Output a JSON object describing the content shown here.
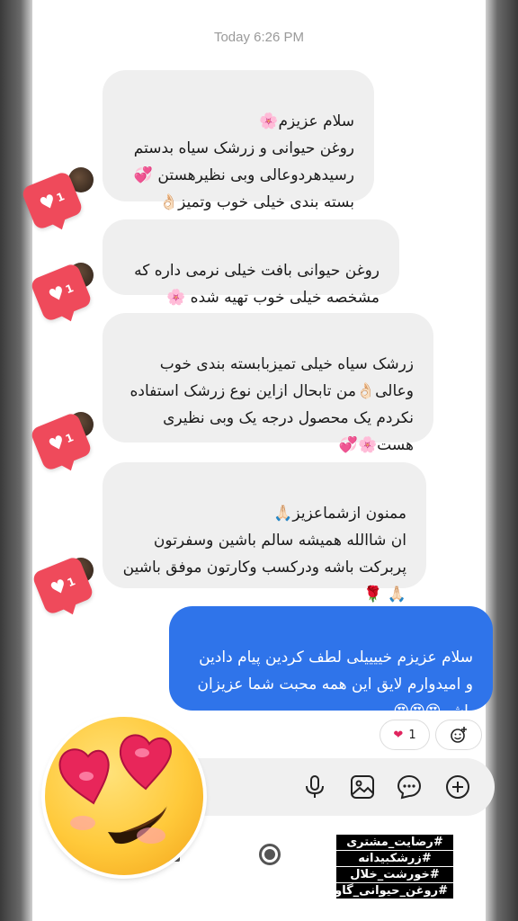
{
  "conversation": {
    "timestamp": "Today 6:26 PM",
    "messages": [
      {
        "from": "them",
        "text": "سلام عزیزم🌸\nروغن حیوانی و زرشک سیاه بدستم\nرسیدهردوعالی وبی نظیرهستن 💞\nبسته بندی خیلی خوب وتمیز👌🏻",
        "likes": "1"
      },
      {
        "from": "them",
        "text": "روغن حیوانی بافت خیلی نرمی داره که\nمشخصه خیلی خوب تهیه شده 🌸",
        "likes": "1"
      },
      {
        "from": "them",
        "text": "زرشک سیاه خیلی تمیزبابسته بندی خوب\nوعالی👌🏻من تابحال ازاین نوع زرشک استفاده\nنکردم یک محصول درجه یک وبی نظیری\nهست🌸💞",
        "likes": "1"
      },
      {
        "from": "them",
        "text": "ممنون ازشماعزیز🙏🏻\nان شاالله همیشه سالم باشین وسفرتون\nپربرکت باشه ودرکسب وکارتون موفق باشین\n🙏🏻 🌹",
        "likes": "1"
      },
      {
        "from": "me",
        "text": "سلام عزیزم خییییلی لطف کردین پیام دادین\nو امیدوارم لایق این همه محبت شما عزیزان\nباشم😍😍😍"
      }
    ],
    "reaction": {
      "emoji": "❤",
      "count": "1"
    },
    "reaction_add_icon": "add-reaction-icon"
  },
  "composer": {
    "icons": [
      "microphone-icon",
      "image-icon",
      "sticker-icon",
      "plus-icon"
    ]
  },
  "overlay": {
    "hashtags": [
      "#رضایت_مشتری",
      "#زرشکبیدانه",
      "#خورشت_خلال",
      "#روغن_حیوانی_گاوی"
    ]
  },
  "colors": {
    "outgoing_bubble": "#2f74ea",
    "incoming_bubble": "#efefef",
    "like_badge": "#ef4a5b"
  }
}
